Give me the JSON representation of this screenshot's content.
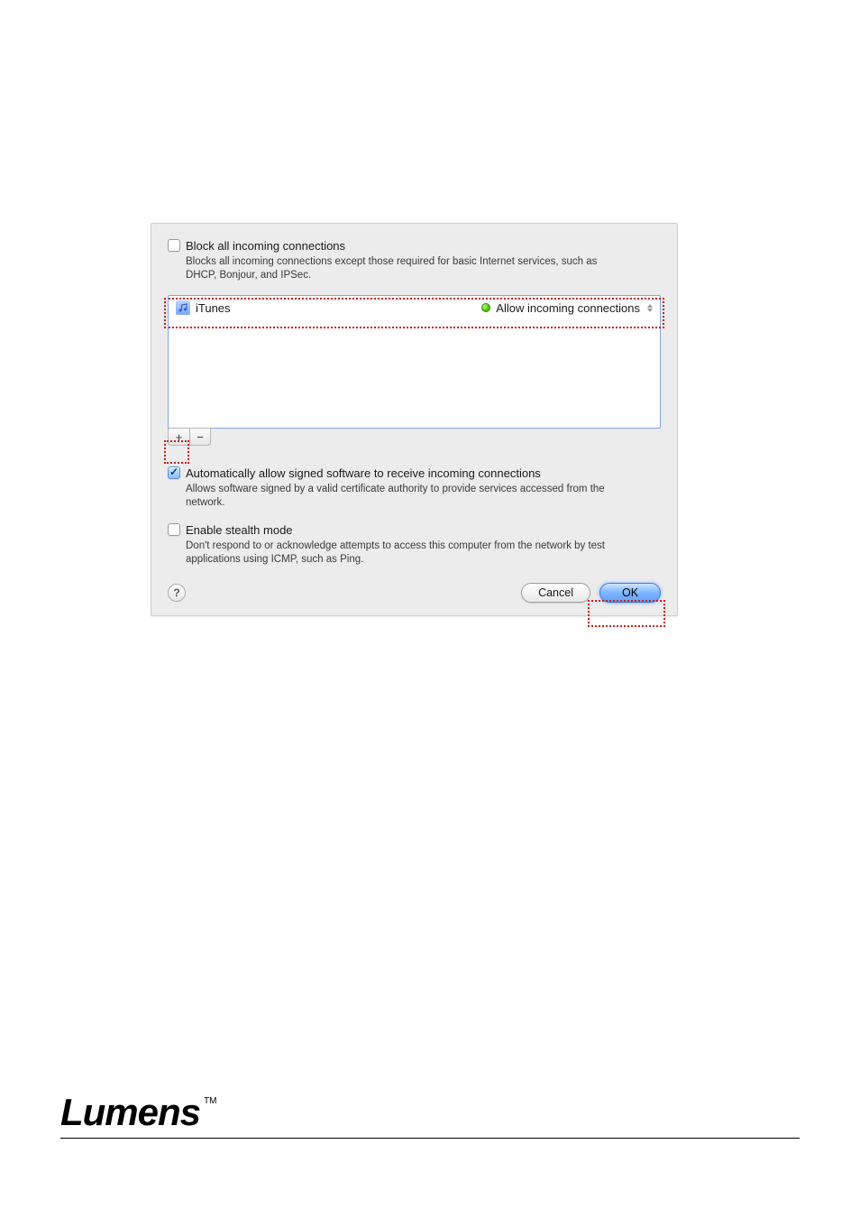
{
  "firewall": {
    "block_all": {
      "title": "Block all incoming connections",
      "desc": "Blocks all incoming connections except those required for basic Internet services, such as DHCP, Bonjour, and IPSec.",
      "checked": false
    },
    "apps": [
      {
        "name": "iTunes",
        "status_text": "Allow incoming connections"
      }
    ],
    "plus_label": "+",
    "minus_label": "−",
    "auto_allow": {
      "title": "Automatically allow signed software to receive incoming connections",
      "desc": "Allows software signed by a valid certificate authority to provide services accessed from the network.",
      "checked": true
    },
    "stealth": {
      "title": "Enable stealth mode",
      "desc": "Don't respond to or acknowledge attempts to access this computer from the network by test applications using ICMP, such as Ping.",
      "checked": false
    },
    "help_label": "?",
    "cancel_label": "Cancel",
    "ok_label": "OK"
  },
  "branding": {
    "logo_text": "Lumens",
    "tm": "TM"
  }
}
